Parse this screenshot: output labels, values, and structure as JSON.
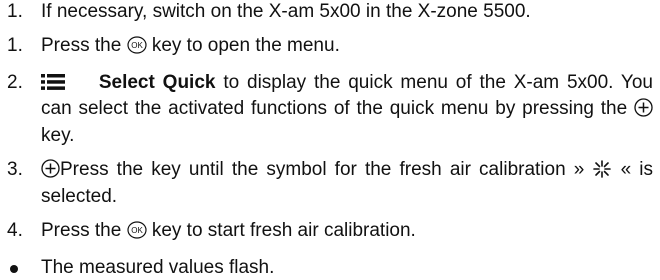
{
  "steps_intro": {
    "marker": "1.",
    "text": "If necessary, switch on the X-am 5x00 in the X-zone 5500."
  },
  "steps": [
    {
      "marker": "1.",
      "pre": "Press the",
      "icon": "ok-key-icon",
      "post": "key to open the menu."
    },
    {
      "marker": "2.",
      "icon": "menu-icon",
      "bold": "Select Quick",
      "post": "to display the quick menu of the X-am 5x00. You can select the activated functions of the quick menu by pressing the",
      "icon2": "plus-key-icon",
      "post2": "key."
    },
    {
      "marker": "3.",
      "icon": "plus-key-icon",
      "pre": "Press the key until the symbol for the fresh air calibration »",
      "icon2": "fresh-air-icon",
      "post": "« is selected."
    },
    {
      "marker": "4.",
      "pre": "Press the",
      "icon": "ok-key-icon",
      "post": "key to start fresh air calibration."
    }
  ],
  "result": {
    "text": "The measured values flash."
  },
  "icon_labels": {
    "ok": "OK"
  }
}
